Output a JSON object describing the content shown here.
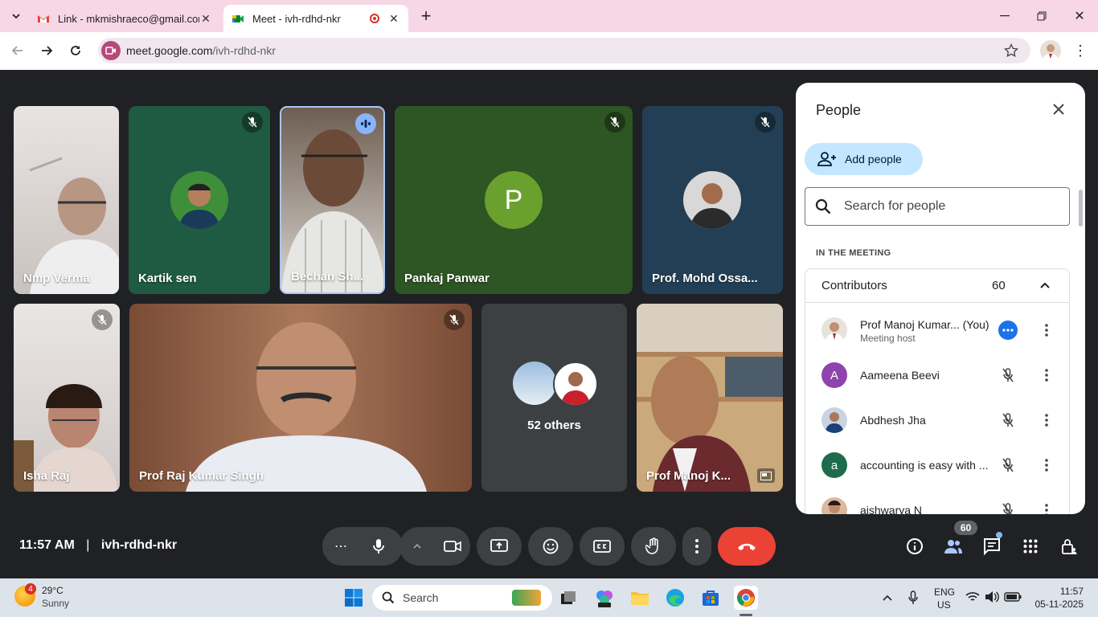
{
  "tabs": [
    {
      "title": "Link - mkmishraeco@gmail.com"
    },
    {
      "title": "Meet - ivh-rdhd-nkr"
    }
  ],
  "address": {
    "domain": "meet.google.com",
    "path": "/ivh-rdhd-nkr"
  },
  "tiles": [
    {
      "name": "Nmp Verma"
    },
    {
      "name": "Kartik sen"
    },
    {
      "name": "Bechan Sh..."
    },
    {
      "name": "Pankaj Panwar",
      "initial": "P"
    },
    {
      "name": "Prof. Mohd Ossa..."
    },
    {
      "name": "Isha Raj"
    },
    {
      "name": "Prof Raj Kumar Singh"
    },
    {
      "name": "52 others"
    },
    {
      "name": "Prof Manoj K..."
    }
  ],
  "panel": {
    "title": "People",
    "add_people_label": "Add people",
    "search_placeholder": "Search for people",
    "section_label": "IN THE MEETING",
    "group_label": "Contributors",
    "group_count": "60",
    "participants": [
      {
        "name": "Prof Manoj Kumar... (You)",
        "sub": "Meeting host",
        "initial": "",
        "color": ""
      },
      {
        "name": "Aameena Beevi",
        "initial": "A",
        "color": "#8e44ad"
      },
      {
        "name": "Abdhesh Jha",
        "initial": "",
        "color": ""
      },
      {
        "name": "accounting is easy with ...",
        "initial": "a",
        "color": "#1e6b4e"
      },
      {
        "name": "aishwarya N",
        "initial": "",
        "color": ""
      }
    ]
  },
  "bottom": {
    "time": "11:57 AM",
    "separator": "|",
    "code": "ivh-rdhd-nkr",
    "people_badge": "60"
  },
  "taskbar": {
    "weather_badge": "4",
    "temp": "29°C",
    "condition": "Sunny",
    "search_label": "Search",
    "lang1": "ENG",
    "lang2": "US",
    "time": "11:57",
    "date": "05-11-2025"
  },
  "colors": {
    "end_call": "#ea4335",
    "accent_blue": "#1a73e8",
    "panel_button": "#c2e7ff"
  }
}
